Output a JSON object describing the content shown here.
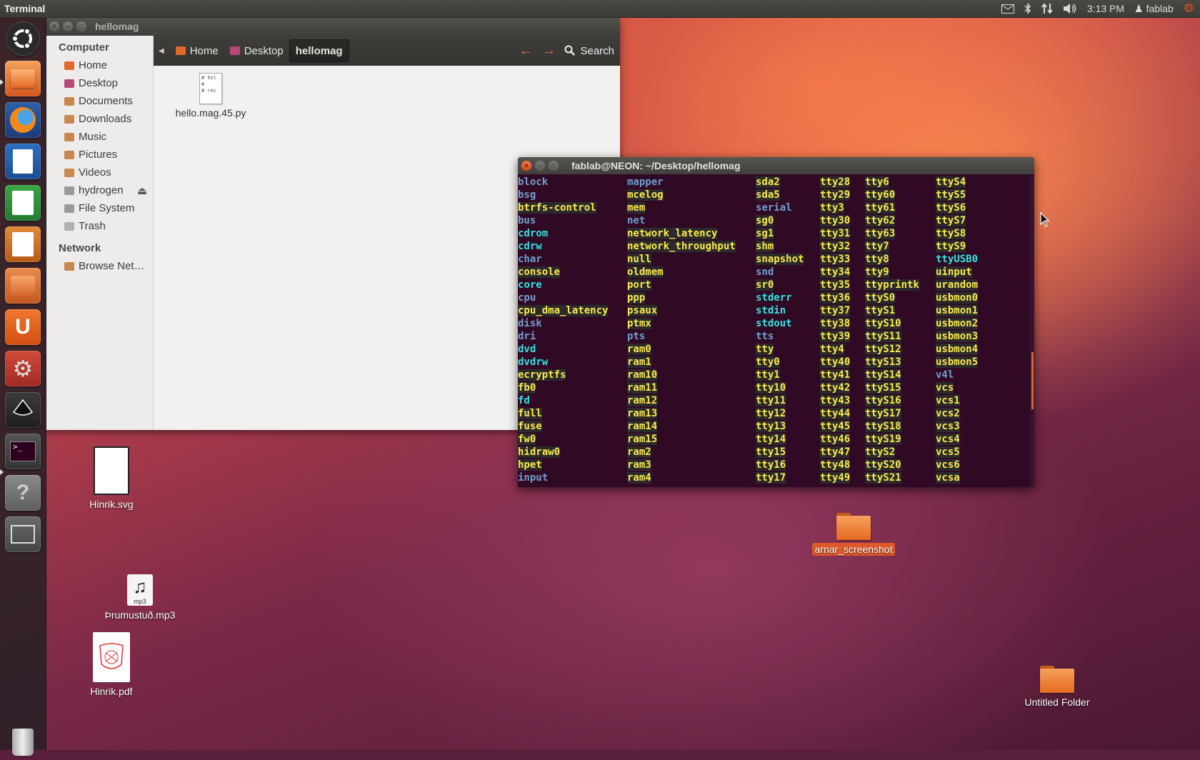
{
  "top_panel": {
    "app_title": "Terminal",
    "time": "3:13 PM",
    "user": "fablab"
  },
  "launcher": {
    "items": [
      "dash-home",
      "files",
      "firefox",
      "writer",
      "calc",
      "impress",
      "software-center",
      "ubuntu-one",
      "system-settings",
      "inkscape",
      "terminal",
      "help",
      "workspace-switcher",
      "trash"
    ]
  },
  "files_window": {
    "title": "hellomag",
    "breadcrumbs": [
      "Home",
      "Desktop",
      "hellomag"
    ],
    "search_label": "Search",
    "sidebar": {
      "computer_heading": "Computer",
      "computer_items": [
        "Home",
        "Desktop",
        "Documents",
        "Downloads",
        "Music",
        "Pictures",
        "Videos",
        "hydrogen",
        "File System",
        "Trash"
      ],
      "network_heading": "Network",
      "network_items": [
        "Browse Net…"
      ]
    },
    "files": [
      {
        "name": "hello.mag.45.py",
        "thumb_lines": [
          "# hel",
          "#",
          "# rec"
        ]
      }
    ]
  },
  "terminal": {
    "title": "fablab@NEON: ~/Desktop/hellomag",
    "columns": [
      [
        {
          "t": "block",
          "c": "dir"
        },
        {
          "t": "bsg",
          "c": "dir"
        },
        {
          "t": "btrfs-control",
          "c": "cdev"
        },
        {
          "t": "bus",
          "c": "dir"
        },
        {
          "t": "cdrom",
          "c": "link"
        },
        {
          "t": "cdrw",
          "c": "link"
        },
        {
          "t": "char",
          "c": "dir"
        },
        {
          "t": "console",
          "c": "cdev"
        },
        {
          "t": "core",
          "c": "link"
        },
        {
          "t": "cpu",
          "c": "dir"
        },
        {
          "t": "cpu_dma_latency",
          "c": "cdev"
        },
        {
          "t": "disk",
          "c": "dir"
        },
        {
          "t": "dri",
          "c": "dir"
        },
        {
          "t": "dvd",
          "c": "link"
        },
        {
          "t": "dvdrw",
          "c": "link"
        },
        {
          "t": "ecryptfs",
          "c": "cdev"
        },
        {
          "t": "fb0",
          "c": "cdev"
        },
        {
          "t": "fd",
          "c": "link"
        },
        {
          "t": "full",
          "c": "cdev"
        },
        {
          "t": "fuse",
          "c": "cdev"
        },
        {
          "t": "fw0",
          "c": "cdev"
        },
        {
          "t": "hidraw0",
          "c": "cdev"
        },
        {
          "t": "hpet",
          "c": "cdev"
        },
        {
          "t": "input",
          "c": "dir"
        }
      ],
      [
        {
          "t": "mapper",
          "c": "dir"
        },
        {
          "t": "mcelog",
          "c": "cdev"
        },
        {
          "t": "mem",
          "c": "cdev"
        },
        {
          "t": "net",
          "c": "dir"
        },
        {
          "t": "network_latency",
          "c": "cdev"
        },
        {
          "t": "network_throughput",
          "c": "cdev"
        },
        {
          "t": "null",
          "c": "cdev"
        },
        {
          "t": "oldmem",
          "c": "cdev"
        },
        {
          "t": "port",
          "c": "cdev"
        },
        {
          "t": "ppp",
          "c": "cdev"
        },
        {
          "t": "psaux",
          "c": "cdev"
        },
        {
          "t": "ptmx",
          "c": "cdev"
        },
        {
          "t": "pts",
          "c": "dir"
        },
        {
          "t": "ram0",
          "c": "cdev"
        },
        {
          "t": "ram1",
          "c": "cdev"
        },
        {
          "t": "ram10",
          "c": "cdev"
        },
        {
          "t": "ram11",
          "c": "cdev"
        },
        {
          "t": "ram12",
          "c": "cdev"
        },
        {
          "t": "ram13",
          "c": "cdev"
        },
        {
          "t": "ram14",
          "c": "cdev"
        },
        {
          "t": "ram15",
          "c": "cdev"
        },
        {
          "t": "ram2",
          "c": "cdev"
        },
        {
          "t": "ram3",
          "c": "cdev"
        },
        {
          "t": "ram4",
          "c": "cdev"
        }
      ],
      [
        {
          "t": "sda2",
          "c": "cdev"
        },
        {
          "t": "sda5",
          "c": "cdev"
        },
        {
          "t": "serial",
          "c": "dir"
        },
        {
          "t": "sg0",
          "c": "cdev"
        },
        {
          "t": "sg1",
          "c": "cdev"
        },
        {
          "t": "shm",
          "c": "cdev"
        },
        {
          "t": "snapshot",
          "c": "cdev"
        },
        {
          "t": "snd",
          "c": "dir"
        },
        {
          "t": "sr0",
          "c": "cdev"
        },
        {
          "t": "stderr",
          "c": "link"
        },
        {
          "t": "stdin",
          "c": "link"
        },
        {
          "t": "stdout",
          "c": "link"
        },
        {
          "t": "tts",
          "c": "dir"
        },
        {
          "t": "tty",
          "c": "cdev"
        },
        {
          "t": "tty0",
          "c": "cdev"
        },
        {
          "t": "tty1",
          "c": "cdev"
        },
        {
          "t": "tty10",
          "c": "cdev"
        },
        {
          "t": "tty11",
          "c": "cdev"
        },
        {
          "t": "tty12",
          "c": "cdev"
        },
        {
          "t": "tty13",
          "c": "cdev"
        },
        {
          "t": "tty14",
          "c": "cdev"
        },
        {
          "t": "tty15",
          "c": "cdev"
        },
        {
          "t": "tty16",
          "c": "cdev"
        },
        {
          "t": "tty17",
          "c": "cdev"
        }
      ],
      [
        {
          "t": "tty28",
          "c": "cdev"
        },
        {
          "t": "tty29",
          "c": "cdev"
        },
        {
          "t": "tty3",
          "c": "cdev"
        },
        {
          "t": "tty30",
          "c": "cdev"
        },
        {
          "t": "tty31",
          "c": "cdev"
        },
        {
          "t": "tty32",
          "c": "cdev"
        },
        {
          "t": "tty33",
          "c": "cdev"
        },
        {
          "t": "tty34",
          "c": "cdev"
        },
        {
          "t": "tty35",
          "c": "cdev"
        },
        {
          "t": "tty36",
          "c": "cdev"
        },
        {
          "t": "tty37",
          "c": "cdev"
        },
        {
          "t": "tty38",
          "c": "cdev"
        },
        {
          "t": "tty39",
          "c": "cdev"
        },
        {
          "t": "tty4",
          "c": "cdev"
        },
        {
          "t": "tty40",
          "c": "cdev"
        },
        {
          "t": "tty41",
          "c": "cdev"
        },
        {
          "t": "tty42",
          "c": "cdev"
        },
        {
          "t": "tty43",
          "c": "cdev"
        },
        {
          "t": "tty44",
          "c": "cdev"
        },
        {
          "t": "tty45",
          "c": "cdev"
        },
        {
          "t": "tty46",
          "c": "cdev"
        },
        {
          "t": "tty47",
          "c": "cdev"
        },
        {
          "t": "tty48",
          "c": "cdev"
        },
        {
          "t": "tty49",
          "c": "cdev"
        }
      ],
      [
        {
          "t": "tty6",
          "c": "cdev"
        },
        {
          "t": "tty60",
          "c": "cdev"
        },
        {
          "t": "tty61",
          "c": "cdev"
        },
        {
          "t": "tty62",
          "c": "cdev"
        },
        {
          "t": "tty63",
          "c": "cdev"
        },
        {
          "t": "tty7",
          "c": "cdev"
        },
        {
          "t": "tty8",
          "c": "cdev"
        },
        {
          "t": "tty9",
          "c": "cdev"
        },
        {
          "t": "ttyprintk",
          "c": "cdev"
        },
        {
          "t": "ttyS0",
          "c": "cdev"
        },
        {
          "t": "ttyS1",
          "c": "cdev"
        },
        {
          "t": "ttyS10",
          "c": "cdev"
        },
        {
          "t": "ttyS11",
          "c": "cdev"
        },
        {
          "t": "ttyS12",
          "c": "cdev"
        },
        {
          "t": "ttyS13",
          "c": "cdev"
        },
        {
          "t": "ttyS14",
          "c": "cdev"
        },
        {
          "t": "ttyS15",
          "c": "cdev"
        },
        {
          "t": "ttyS16",
          "c": "cdev"
        },
        {
          "t": "ttyS17",
          "c": "cdev"
        },
        {
          "t": "ttyS18",
          "c": "cdev"
        },
        {
          "t": "ttyS19",
          "c": "cdev"
        },
        {
          "t": "ttyS2",
          "c": "cdev"
        },
        {
          "t": "ttyS20",
          "c": "cdev"
        },
        {
          "t": "ttyS21",
          "c": "cdev"
        }
      ],
      [
        {
          "t": "ttyS4",
          "c": "cdev"
        },
        {
          "t": "ttyS5",
          "c": "cdev"
        },
        {
          "t": "ttyS6",
          "c": "cdev"
        },
        {
          "t": "ttyS7",
          "c": "cdev"
        },
        {
          "t": "ttyS8",
          "c": "cdev"
        },
        {
          "t": "ttyS9",
          "c": "cdev"
        },
        {
          "t": "ttyUSB0",
          "c": "link"
        },
        {
          "t": "uinput",
          "c": "cdev"
        },
        {
          "t": "urandom",
          "c": "cdev"
        },
        {
          "t": "usbmon0",
          "c": "cdev"
        },
        {
          "t": "usbmon1",
          "c": "cdev"
        },
        {
          "t": "usbmon2",
          "c": "cdev"
        },
        {
          "t": "usbmon3",
          "c": "cdev"
        },
        {
          "t": "usbmon4",
          "c": "cdev"
        },
        {
          "t": "usbmon5",
          "c": "cdev"
        },
        {
          "t": "v4l",
          "c": "dir"
        },
        {
          "t": "vcs",
          "c": "cdev"
        },
        {
          "t": "vcs1",
          "c": "cdev"
        },
        {
          "t": "vcs2",
          "c": "cdev"
        },
        {
          "t": "vcs3",
          "c": "cdev"
        },
        {
          "t": "vcs4",
          "c": "cdev"
        },
        {
          "t": "vcs5",
          "c": "cdev"
        },
        {
          "t": "vcs6",
          "c": "cdev"
        },
        {
          "t": "vcsa",
          "c": "cdev"
        }
      ]
    ]
  },
  "desktop_icons": {
    "hinrik_svg": "Hinrik.svg",
    "mp3": "Þrumustuð.mp3",
    "mp3_badge": "mp3",
    "hinrik_pdf": "Hinrik.pdf",
    "arnar": "arnar_screenshot",
    "untitled": "Untitled Folder"
  },
  "colors": {
    "terminal_bg": "#300a24",
    "dir": "#729fcf",
    "cdev": "#fce94f",
    "link": "#34e2e2",
    "accent": "#dd4814"
  }
}
